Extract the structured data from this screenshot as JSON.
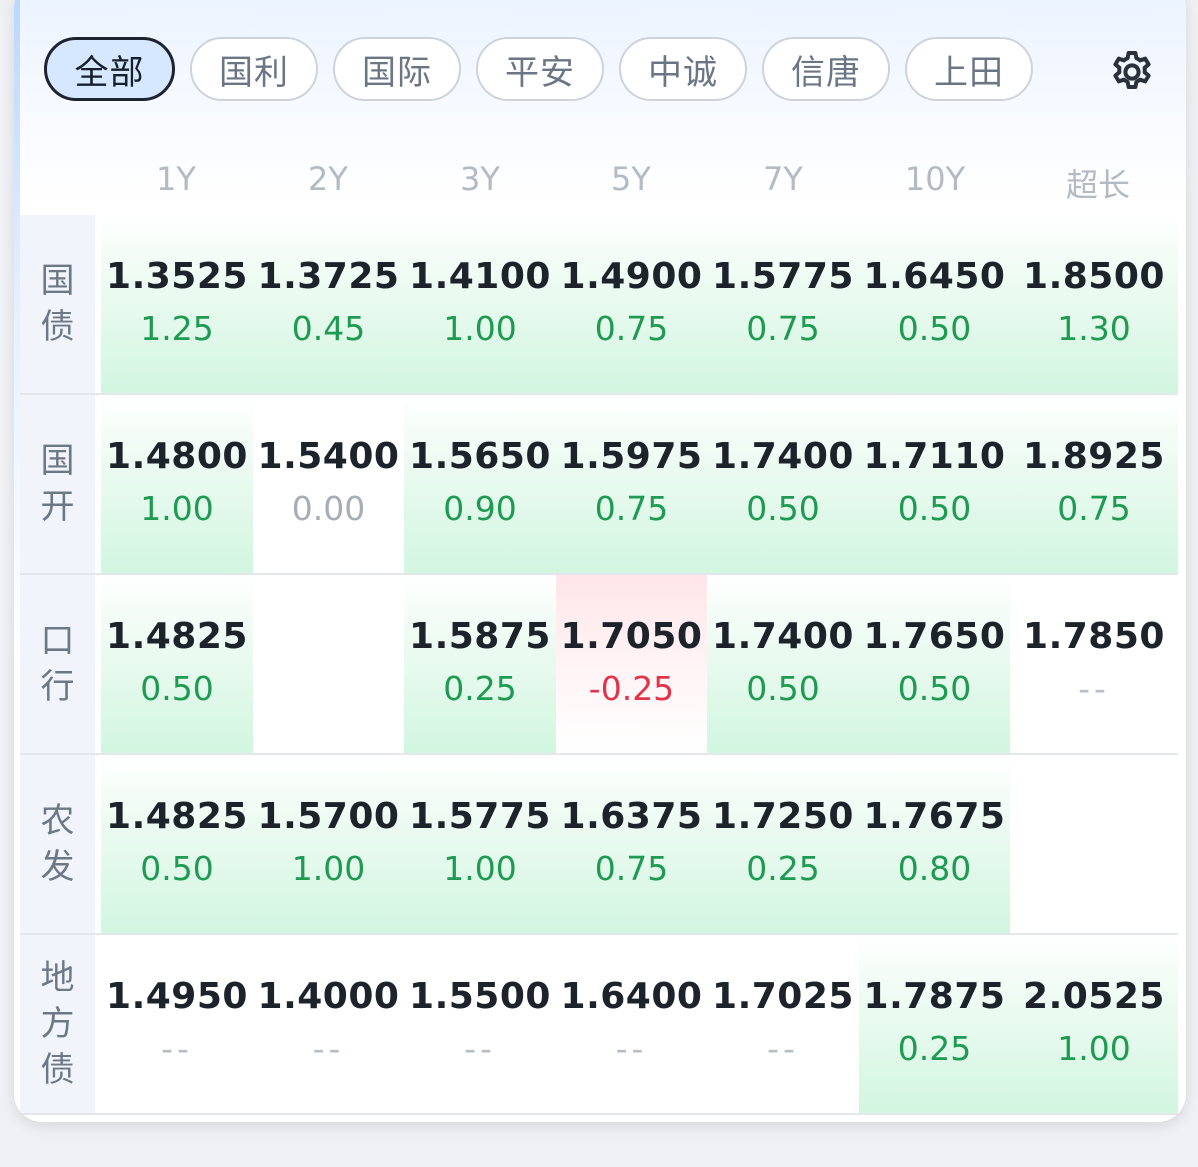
{
  "tabs": [
    {
      "label": "全部",
      "active": true
    },
    {
      "label": "国利",
      "active": false
    },
    {
      "label": "国际",
      "active": false
    },
    {
      "label": "平安",
      "active": false
    },
    {
      "label": "中诚",
      "active": false
    },
    {
      "label": "信唐",
      "active": false
    },
    {
      "label": "上田",
      "active": false
    }
  ],
  "settings_icon": "gear-icon",
  "columns": [
    "1Y",
    "2Y",
    "3Y",
    "5Y",
    "7Y",
    "10Y",
    "超长"
  ],
  "colors": {
    "up": "#1f9a52",
    "down": "#e2334a",
    "flat": "#a7adb5",
    "active_tab_bg": "#d6e8ff"
  },
  "rows": [
    {
      "label": [
        "国",
        "债"
      ],
      "cells": [
        {
          "yield": "1.3525",
          "change": "1.25",
          "trend": "up"
        },
        {
          "yield": "1.3725",
          "change": "0.45",
          "trend": "up"
        },
        {
          "yield": "1.4100",
          "change": "1.00",
          "trend": "up"
        },
        {
          "yield": "1.4900",
          "change": "0.75",
          "trend": "up"
        },
        {
          "yield": "1.5775",
          "change": "0.75",
          "trend": "up"
        },
        {
          "yield": "1.6450",
          "change": "0.50",
          "trend": "up"
        },
        {
          "yield": "1.8500",
          "change": "1.30",
          "trend": "up"
        }
      ]
    },
    {
      "label": [
        "国",
        "开"
      ],
      "cells": [
        {
          "yield": "1.4800",
          "change": "1.00",
          "trend": "up"
        },
        {
          "yield": "1.5400",
          "change": "0.00",
          "trend": "flat"
        },
        {
          "yield": "1.5650",
          "change": "0.90",
          "trend": "up"
        },
        {
          "yield": "1.5975",
          "change": "0.75",
          "trend": "up"
        },
        {
          "yield": "1.7400",
          "change": "0.50",
          "trend": "up"
        },
        {
          "yield": "1.7110",
          "change": "0.50",
          "trend": "up"
        },
        {
          "yield": "1.8925",
          "change": "0.75",
          "trend": "up"
        }
      ]
    },
    {
      "label": [
        "口",
        "行"
      ],
      "cells": [
        {
          "yield": "1.4825",
          "change": "0.50",
          "trend": "up"
        },
        {
          "yield": "",
          "change": "",
          "trend": "empty"
        },
        {
          "yield": "1.5875",
          "change": "0.25",
          "trend": "up"
        },
        {
          "yield": "1.7050",
          "change": "-0.25",
          "trend": "down"
        },
        {
          "yield": "1.7400",
          "change": "0.50",
          "trend": "up"
        },
        {
          "yield": "1.7650",
          "change": "0.50",
          "trend": "up"
        },
        {
          "yield": "1.7850",
          "change": "--",
          "trend": "none"
        }
      ]
    },
    {
      "label": [
        "农",
        "发"
      ],
      "cells": [
        {
          "yield": "1.4825",
          "change": "0.50",
          "trend": "up"
        },
        {
          "yield": "1.5700",
          "change": "1.00",
          "trend": "up"
        },
        {
          "yield": "1.5775",
          "change": "1.00",
          "trend": "up"
        },
        {
          "yield": "1.6375",
          "change": "0.75",
          "trend": "up"
        },
        {
          "yield": "1.7250",
          "change": "0.25",
          "trend": "up"
        },
        {
          "yield": "1.7675",
          "change": "0.80",
          "trend": "up"
        },
        {
          "yield": "",
          "change": "",
          "trend": "empty"
        }
      ]
    },
    {
      "label": [
        "地",
        "方",
        "债"
      ],
      "cells": [
        {
          "yield": "1.4950",
          "change": "--",
          "trend": "none"
        },
        {
          "yield": "1.4000",
          "change": "--",
          "trend": "none"
        },
        {
          "yield": "1.5500",
          "change": "--",
          "trend": "none"
        },
        {
          "yield": "1.6400",
          "change": "--",
          "trend": "none"
        },
        {
          "yield": "1.7025",
          "change": "--",
          "trend": "none"
        },
        {
          "yield": "1.7875",
          "change": "0.25",
          "trend": "up"
        },
        {
          "yield": "2.0525",
          "change": "1.00",
          "trend": "up"
        }
      ]
    }
  ]
}
